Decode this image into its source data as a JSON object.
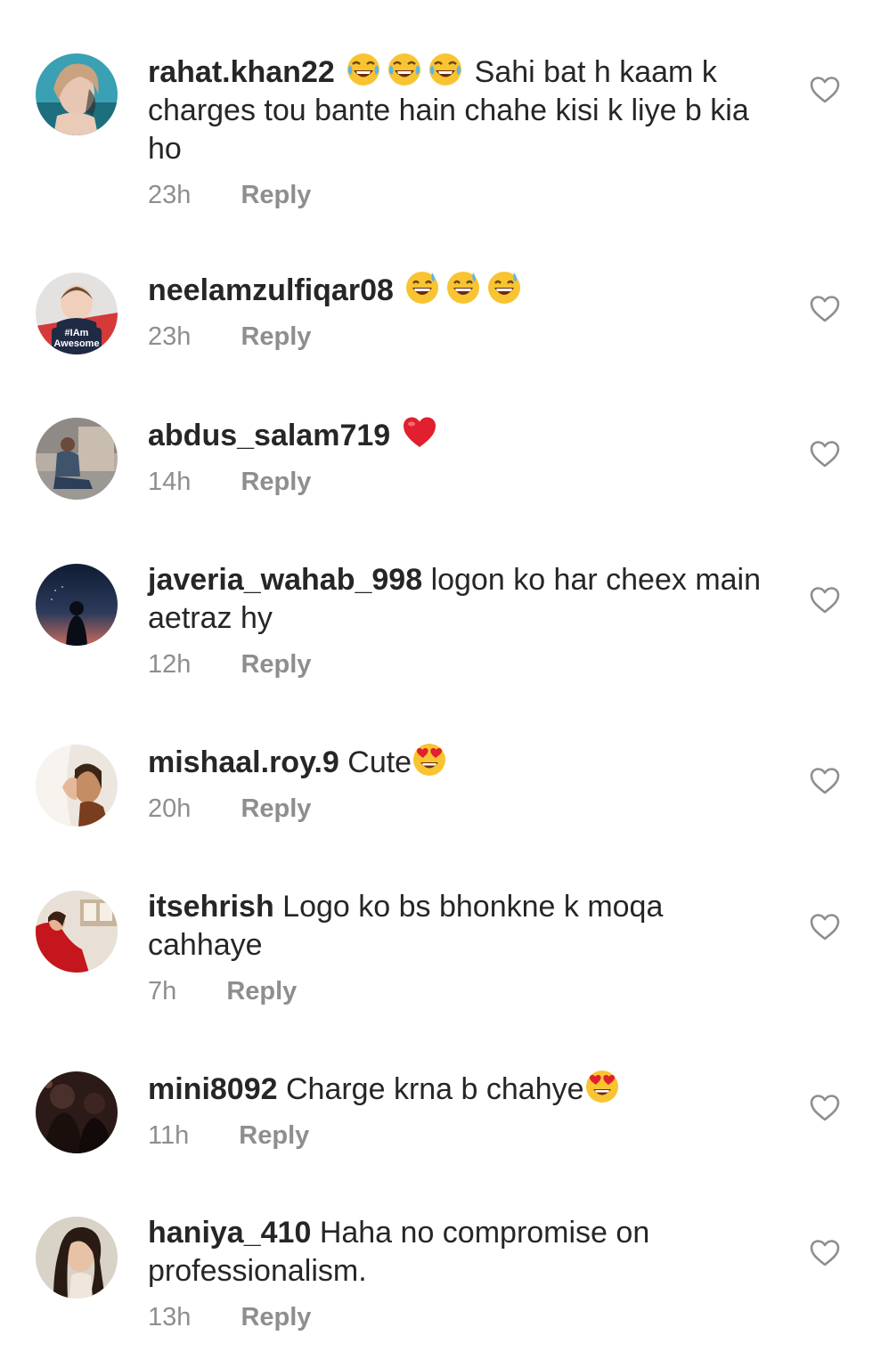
{
  "comments": [
    {
      "username": "rahat.khan22",
      "text": "Sahi bat h kaam k charges tou bante hain chahe kisi k liye b kia ho",
      "time": "23h",
      "reply_label": "Reply",
      "emoji_before": [
        "face-with-tears-of-joy",
        "face-with-tears-of-joy",
        "face-with-tears-of-joy"
      ],
      "emoji_after": []
    },
    {
      "username": "neelamzulfiqar08",
      "text": "",
      "time": "23h",
      "reply_label": "Reply",
      "avatar_caption": "#IAm Awesome",
      "emoji_before": [
        "grinning-face-with-sweat",
        "grinning-face-with-sweat",
        "grinning-face-with-sweat"
      ],
      "emoji_after": []
    },
    {
      "username": "abdus_salam719",
      "text": "",
      "time": "14h",
      "reply_label": "Reply",
      "emoji_before": [
        "red-heart"
      ],
      "emoji_after": []
    },
    {
      "username": "javeria_wahab_998",
      "text": "logon ko har cheex main aetraz hy",
      "time": "12h",
      "reply_label": "Reply",
      "emoji_before": [],
      "emoji_after": []
    },
    {
      "username": "mishaal.roy.9",
      "text": "Cute",
      "time": "20h",
      "reply_label": "Reply",
      "emoji_before": [],
      "emoji_after": [
        "smiling-face-with-heart-eyes"
      ]
    },
    {
      "username": "itsehrish",
      "text": "Logo ko bs bhonkne k moqa cahhaye",
      "time": "7h",
      "reply_label": "Reply",
      "emoji_before": [],
      "emoji_after": []
    },
    {
      "username": "mini8092",
      "text": "Charge krna b chahye",
      "time": "11h",
      "reply_label": "Reply",
      "emoji_before": [],
      "emoji_after": [
        "smiling-face-with-heart-eyes"
      ]
    },
    {
      "username": "haniya_410",
      "text": "Haha no compromise on professionalism.",
      "time": "13h",
      "reply_label": "Reply",
      "emoji_before": [],
      "emoji_after": []
    }
  ],
  "icons": {
    "like": "heart-outline-icon"
  },
  "colors": {
    "text": "#262626",
    "meta": "#8e8e8e",
    "heart_outline": "#8e8e8e"
  }
}
